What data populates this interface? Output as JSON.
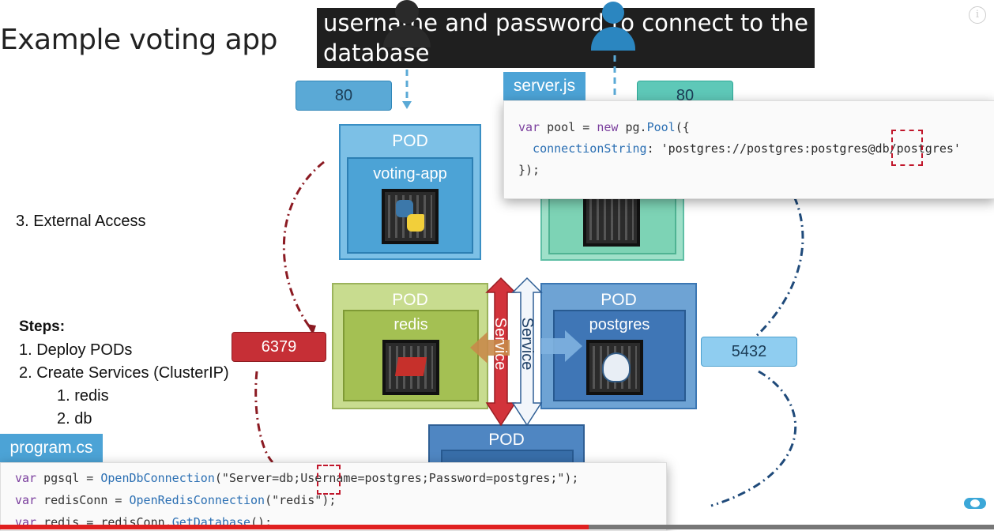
{
  "slide": {
    "title": "Example voting app",
    "external_access": "3.   External Access",
    "steps_heading": "Steps:",
    "steps": [
      "1.   Deploy PODs",
      "2.   Create Services (ClusterIP)"
    ],
    "substeps": [
      "1.   redis",
      "2.   db"
    ]
  },
  "caption": {
    "line1": "username and password to connect to the",
    "line2": "database"
  },
  "ports": {
    "voting": "80",
    "result": "80",
    "redis": "6379",
    "db": "5432"
  },
  "pods": {
    "pod_label": "POD",
    "voting_app": "voting-app",
    "redis": "redis",
    "postgres": "postgres"
  },
  "service": {
    "left": "Service",
    "right": "Service"
  },
  "server_js": {
    "tab": "server.js",
    "line1": [
      "var",
      " pool = ",
      "new",
      " pg.",
      "Pool",
      "({"
    ],
    "line2": [
      "  connectionString",
      ": 'postgres://postgres:postgres@db/postgres'"
    ],
    "line3": "});"
  },
  "program_cs": {
    "tab": "program.cs",
    "line1": [
      "var",
      " pgsql = ",
      "OpenDbConnection",
      "(\"Server=db;Username=postgres;Password=postgres;\");"
    ],
    "line2": [
      "var",
      " redisConn = ",
      "OpenRedisConnection",
      "(\"redis\");"
    ],
    "line3": [
      "var",
      " redis = redisConn.",
      "GetDatabase",
      "();"
    ]
  },
  "colors": {
    "pod_blue": "#7cc0e6",
    "pod_green": "#c8dc8f",
    "pod_teal": "#9fe0c9",
    "pod_postgres": "#4f86c2",
    "service_red": "#d2333b",
    "accent_red": "#c0162b"
  }
}
